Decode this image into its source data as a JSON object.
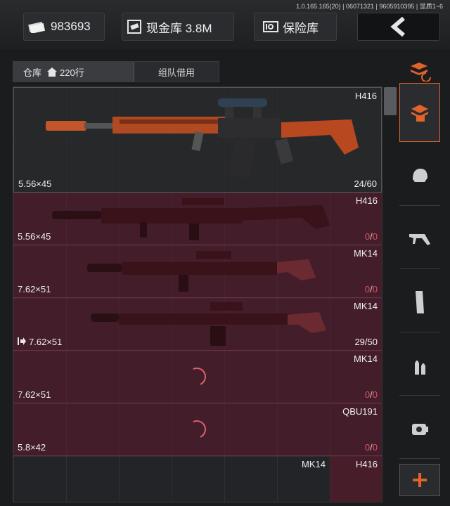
{
  "header": {
    "version": "1.0.165.165(20) | 06071321 | 9605910395 | 显质1~6",
    "money": "983693",
    "cash_vault": "现金库 3.8M",
    "safe": "保险库"
  },
  "tabs": {
    "warehouse_label": "仓库",
    "warehouse_count": "220行",
    "team_borrow": "组队借用"
  },
  "weapons": [
    {
      "name": "H416",
      "caliber": "5.56×45",
      "ammo": "24/60",
      "ammo_current": "24",
      "ammo_max": "60",
      "state": "selected"
    },
    {
      "name": "H416",
      "caliber": "5.56×45",
      "ammo_current": "0",
      "ammo_max": "0",
      "state": "unavailable"
    },
    {
      "name": "MK14",
      "caliber": "7.62×51",
      "ammo_current": "0",
      "ammo_max": "0",
      "state": "unavailable"
    },
    {
      "name": "MK14",
      "caliber": "7.62×51",
      "ammo": "29/50",
      "state": "unavailable"
    },
    {
      "name": "MK14",
      "caliber": "7.62×51",
      "ammo_current": "0",
      "ammo_max": "0",
      "state": "loading"
    },
    {
      "name": "QBU191",
      "caliber": "5.8×42",
      "ammo_current": "0",
      "ammo_max": "0",
      "state": "loading"
    }
  ],
  "last_row": {
    "left_name": "MK14",
    "right_name": "H416"
  },
  "sidebar": {
    "items": [
      "weapon-box-icon",
      "helmet-icon",
      "rifle-icon",
      "magazine-icon",
      "bullets-icon",
      "scope-icon"
    ]
  },
  "colors": {
    "accent": "#e0632a",
    "red_row": "#5f192d",
    "zero_ammo": "#e0506a"
  }
}
